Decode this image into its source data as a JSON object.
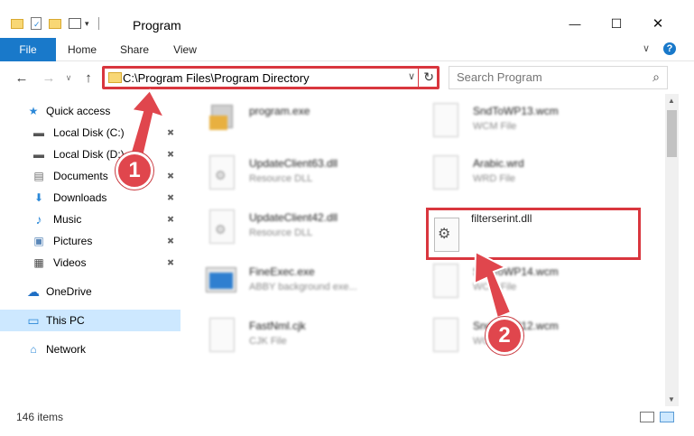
{
  "titlebar": {
    "title": "Program",
    "minimize": "—",
    "maximize": "☐",
    "close": "✕"
  },
  "ribbon": {
    "tabs": [
      {
        "label": "File"
      },
      {
        "label": "Home"
      },
      {
        "label": "Share"
      },
      {
        "label": "View"
      }
    ],
    "help": "?",
    "expand": "∨"
  },
  "address": {
    "path": "C:\\Program Files\\Program Directory",
    "back": "←",
    "forward": "→",
    "recent": "∨",
    "up": "↑",
    "refresh": "↻",
    "dropdown": "∨"
  },
  "search": {
    "placeholder": "Search Program",
    "icon": "⌕"
  },
  "sidebar": {
    "items": [
      {
        "label": "Quick access",
        "icon": "star-icon",
        "glyph": "★",
        "color": "#2b88d8"
      },
      {
        "label": "Local Disk (C:)",
        "icon": "drive-icon",
        "glyph": "▬",
        "color": "#555555"
      },
      {
        "label": "Local Disk (D:)",
        "icon": "drive-icon",
        "glyph": "▬",
        "color": "#555555"
      },
      {
        "label": "Documents",
        "icon": "documents-icon",
        "glyph": "▤",
        "color": "#6d6d6d"
      },
      {
        "label": "Downloads",
        "icon": "download-icon",
        "glyph": "⬇",
        "color": "#2b88d8"
      },
      {
        "label": "Music",
        "icon": "music-icon",
        "glyph": "♪",
        "color": "#2b88d8"
      },
      {
        "label": "Pictures",
        "icon": "pictures-icon",
        "glyph": "▣",
        "color": "#5a87b8"
      },
      {
        "label": "Videos",
        "icon": "videos-icon",
        "glyph": "▦",
        "color": "#555555"
      },
      {
        "label": "OneDrive",
        "icon": "cloud-icon",
        "glyph": "☁",
        "color": "#1f6fc5"
      },
      {
        "label": "This PC",
        "icon": "computer-icon",
        "glyph": "▭",
        "color": "#2b88d8"
      },
      {
        "label": "Network",
        "icon": "network-icon",
        "glyph": "⌂",
        "color": "#2b88d8"
      }
    ],
    "pin": "📌"
  },
  "files": {
    "col1": [
      {
        "name": "program.exe",
        "type": ""
      },
      {
        "name": "UpdateClient63.dll",
        "type": "Resource DLL"
      },
      {
        "name": "UpdateClient42.dll",
        "type": "Resource DLL"
      },
      {
        "name": "FineExec.exe",
        "type": "ABBY background exe..."
      },
      {
        "name": "FastNml.cjk",
        "type": "CJK File"
      }
    ],
    "col2": [
      {
        "name": "SndToWP13.wcm",
        "type": "WCM File"
      },
      {
        "name": "Arabic.wrd",
        "type": "WRD File"
      },
      {
        "name": "SndToWP14.wcm",
        "type": "WCM File"
      },
      {
        "name": "SndToWP12.wcm",
        "type": "WCM File"
      }
    ],
    "highlighted": {
      "name": "filterserint.dll"
    }
  },
  "callouts": {
    "one": "1",
    "two": "2"
  },
  "status": {
    "count": "146 items"
  },
  "colors": {
    "accent": "#1979ca",
    "highlight": "#d9363e",
    "selected_nav": "#cde8ff"
  }
}
